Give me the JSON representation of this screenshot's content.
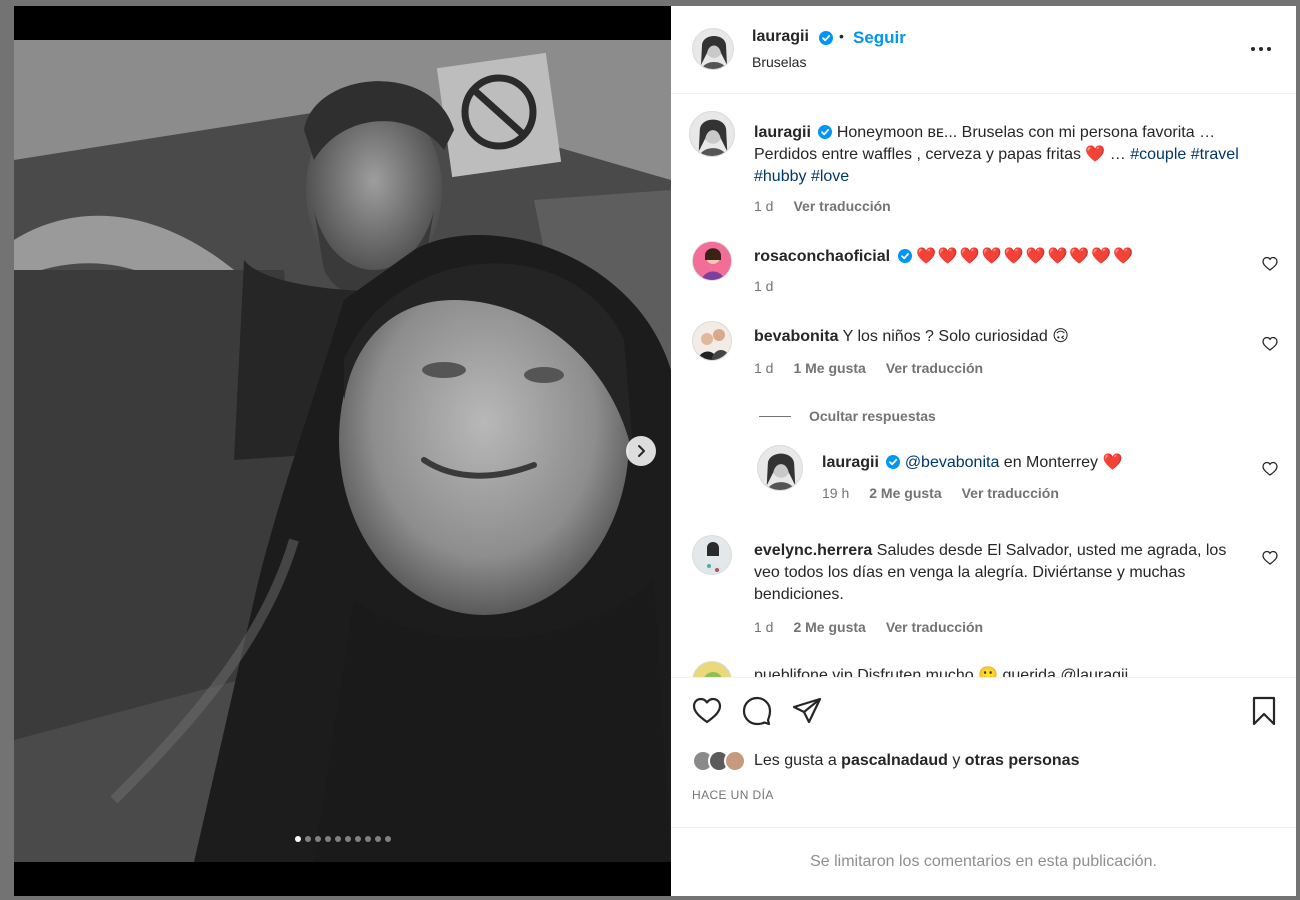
{
  "post": {
    "author": "lauragii",
    "follow_label": "Seguir",
    "separator": "•",
    "location": "Bruselas",
    "caption": {
      "user": "lauragii",
      "text": "Honeymoon ʙᴇ... Bruselas con mi persona favorita … Perdidos entre waffles , cerveza y papas fritas ❤️ … ",
      "hashtags": "#couple #travel #hubby #love",
      "time": "1 d",
      "translate": "Ver traducción"
    },
    "carousel": {
      "count": 10,
      "active": 0
    }
  },
  "comments": [
    {
      "user": "rosaconchaoficial",
      "text": "❤️❤️❤️❤️❤️❤️❤️❤️❤️❤️",
      "time": "1 d",
      "likes": "",
      "translate": ""
    },
    {
      "user": "bevabonita",
      "text": "Y los niños ? Solo curiosidad 🙃",
      "time": "1 d",
      "likes": "1 Me gusta",
      "translate": "Ver traducción"
    },
    {
      "user": "evelync.herrera",
      "text": "Saludes desde El Salvador, usted me agrada, los veo todos los días en venga la alegría. Diviértanse y muchas bendiciones.",
      "time": "1 d",
      "likes": "2 Me gusta",
      "translate": "Ver traducción"
    }
  ],
  "replies": {
    "hide_label": "Ocultar respuestas",
    "items": [
      {
        "user": "lauragii",
        "mention": "@bevabonita",
        "text": " en Monterrey ❤️",
        "time": "19 h",
        "likes": "2 Me gusta",
        "translate": "Ver traducción"
      }
    ]
  },
  "partial_comment": "pueblifone.vip  Disfruten mucho  🙂  querida  @lauragii",
  "engagement": {
    "likes_prefix": "Les gusta a ",
    "likes_user": "pascalnadaud",
    "likes_mid": " y ",
    "likes_suffix": "otras personas",
    "timestamp": "HACE UN DÍA"
  },
  "footer": {
    "text": "Se limitaron los comentarios en esta publicación."
  },
  "colors": {
    "link": "#0095f6",
    "hashtag": "#00376b",
    "heart": "#ed4956",
    "verified": "#0095f6"
  }
}
